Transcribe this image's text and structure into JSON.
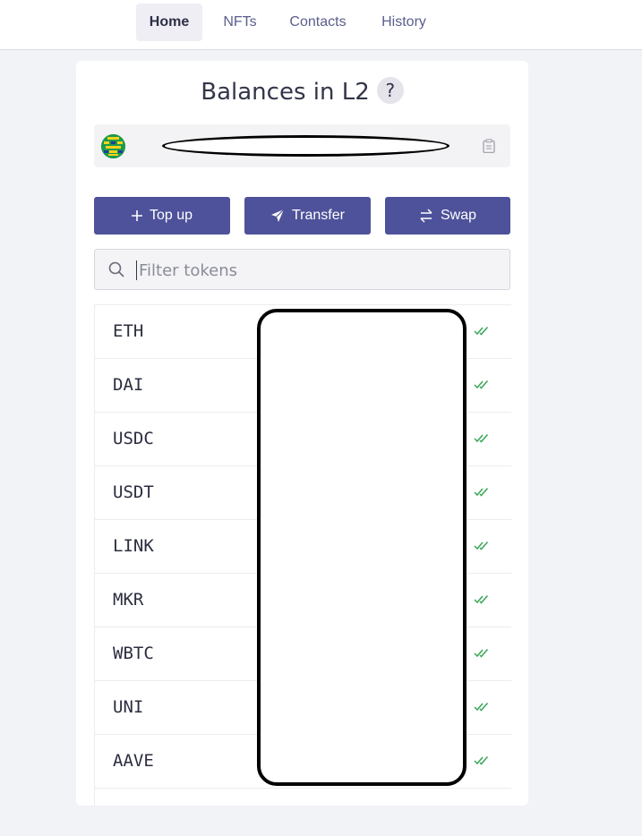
{
  "nav": {
    "tabs": [
      {
        "label": "Home",
        "active": true
      },
      {
        "label": "NFTs",
        "active": false
      },
      {
        "label": "Contacts",
        "active": false
      },
      {
        "label": "History",
        "active": false
      }
    ]
  },
  "header": {
    "title": "Balances in L2",
    "help_label": "?"
  },
  "account": {
    "address_redacted": true,
    "avatar_icon": "identicon-avatar",
    "copy_icon": "clipboard-icon"
  },
  "actions": {
    "topup_label": "Top up",
    "transfer_label": "Transfer",
    "swap_label": "Swap"
  },
  "search": {
    "placeholder": "Filter tokens",
    "value": ""
  },
  "tokens": [
    {
      "symbol": "ETH",
      "status_icon": "double-check-icon"
    },
    {
      "symbol": "DAI",
      "status_icon": "double-check-icon"
    },
    {
      "symbol": "USDC",
      "status_icon": "double-check-icon"
    },
    {
      "symbol": "USDT",
      "status_icon": "double-check-icon"
    },
    {
      "symbol": "LINK",
      "status_icon": "double-check-icon"
    },
    {
      "symbol": "MKR",
      "status_icon": "double-check-icon"
    },
    {
      "symbol": "WBTC",
      "status_icon": "double-check-icon"
    },
    {
      "symbol": "UNI",
      "status_icon": "double-check-icon"
    },
    {
      "symbol": "AAVE",
      "status_icon": "double-check-icon"
    }
  ],
  "colors": {
    "accent": "#4e529a",
    "status_green": "#3aa657",
    "background": "#f2f3f7"
  }
}
